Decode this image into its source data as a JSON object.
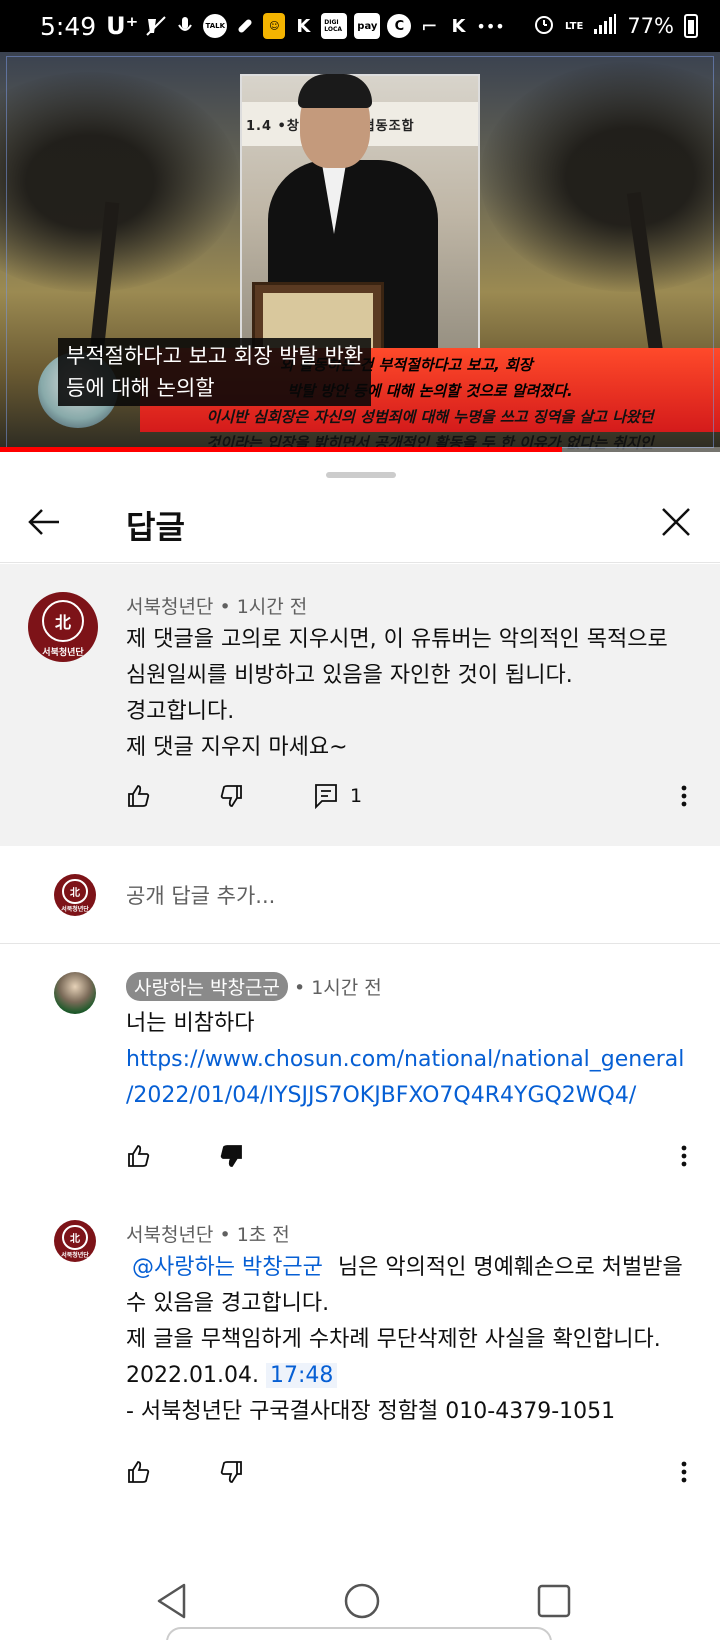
{
  "status_bar": {
    "time": "5:49",
    "carrier": "U⁺",
    "notif_talk": "TALK",
    "notif_digi": "DIGI LOCA",
    "notif_pay": "pay",
    "notif_c": "C",
    "notif_more": "•••",
    "network": "LTE",
    "battery": "77%"
  },
  "video": {
    "banner_text": "1.4  •창  딩 연예인협동조합",
    "caption_line1": "부적절하다고 보고 회장 박탈 반환",
    "caption_line2": "등에 대해 논의할",
    "ticker_line1": "와 활동하는 건 부적절하다고 보고, 회장",
    "ticker_line2": "박탈 방안 등에 대해 논의할 것으로 알려졌다.",
    "ticker_line3": "이시반 심회장은 자신의 성범죄에 대해 누명을 쓰고 징역을 살고 나왔던",
    "ticker_line4": "것이라는 입장을 밝히면서 공개적인 활동을 두 한 이유가 없다는 취지인",
    "progress": 0.78
  },
  "sheet": {
    "title": "답글"
  },
  "parent_comment": {
    "author": "서북청년단",
    "time": "1시간 전",
    "lines": [
      "제 댓글을 고의로 지우시면, 이 유튜버는 악의적인 목적으로",
      "심원일씨를 비방하고 있음을 자인한 것이 됩니다.",
      "경고합니다.",
      "제 댓글 지우지 마세요~"
    ],
    "reply_count": "1",
    "avatar_seal": "北",
    "avatar_text": "서북청년단"
  },
  "add_reply": {
    "placeholder": "공개 답글 추가...",
    "avatar_seal": "北",
    "avatar_text": "서북청년단"
  },
  "replies": [
    {
      "author": "사랑하는 박창근군",
      "time": "1시간 전",
      "text": "너는 비참하다",
      "link_line1": "https://www.chosun.com/national/national_general",
      "link_line2": "/2022/01/04/IYSJJS7OKJBFXO7Q4R4YGQ2WQ4/"
    },
    {
      "author": "서북청년단",
      "time": "1초 전",
      "mention": "@사랑하는 박창근군",
      "line1_rest": "님은 악의적인 명예훼손으로 처벌받을",
      "line2": "수 있음을 경고합니다.",
      "line3": "제 글을 무책임하게 수차례 무단삭제한 사실을 확인합니다.",
      "date": "2022.01.04.",
      "timestamp": "17:48",
      "signature": "- 서북청년단 구국결사대장 정함철 010-4379-1051",
      "avatar_seal": "北",
      "avatar_text": "서북청년단"
    }
  ],
  "colors": {
    "accent_link": "#065fd4",
    "avatar_brand": "#7d1318",
    "progress": "#ff0000"
  }
}
